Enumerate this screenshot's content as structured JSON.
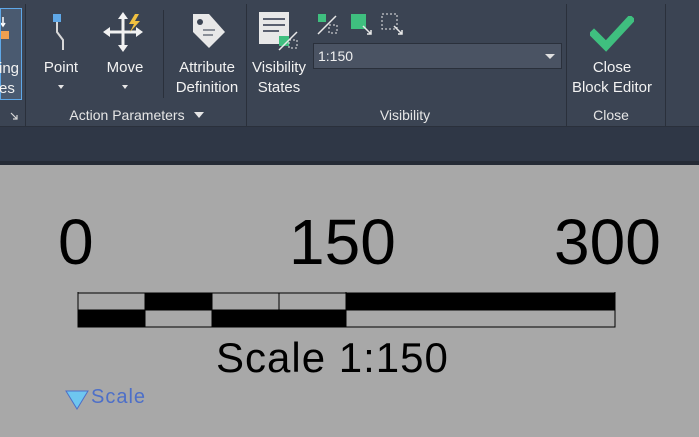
{
  "ribbon": {
    "partial_button": {
      "line1": "ing",
      "line2": "es"
    },
    "point": {
      "label": "Point"
    },
    "move": {
      "label": "Move"
    },
    "attribute_definition": {
      "line1": "Attribute",
      "line2": "Definition"
    },
    "visibility_states": {
      "line1": "Visibility",
      "line2": "States"
    },
    "visibility_dropdown": {
      "value": "1:150"
    },
    "close_block_editor": {
      "line1": "Close",
      "line2": "Block Editor"
    },
    "panels": {
      "action_parameters": "Action Parameters",
      "visibility": "Visibility",
      "close": "Close"
    },
    "colors": {
      "background": "#3b4453",
      "check": "#3fbf7f",
      "accent": "#5fa8e8"
    }
  },
  "drawing": {
    "tick_labels": [
      "0",
      "150",
      "300"
    ],
    "scale_label": "Scale 1:150",
    "parameter_label": "Scale",
    "background": "#a8a8a8"
  }
}
